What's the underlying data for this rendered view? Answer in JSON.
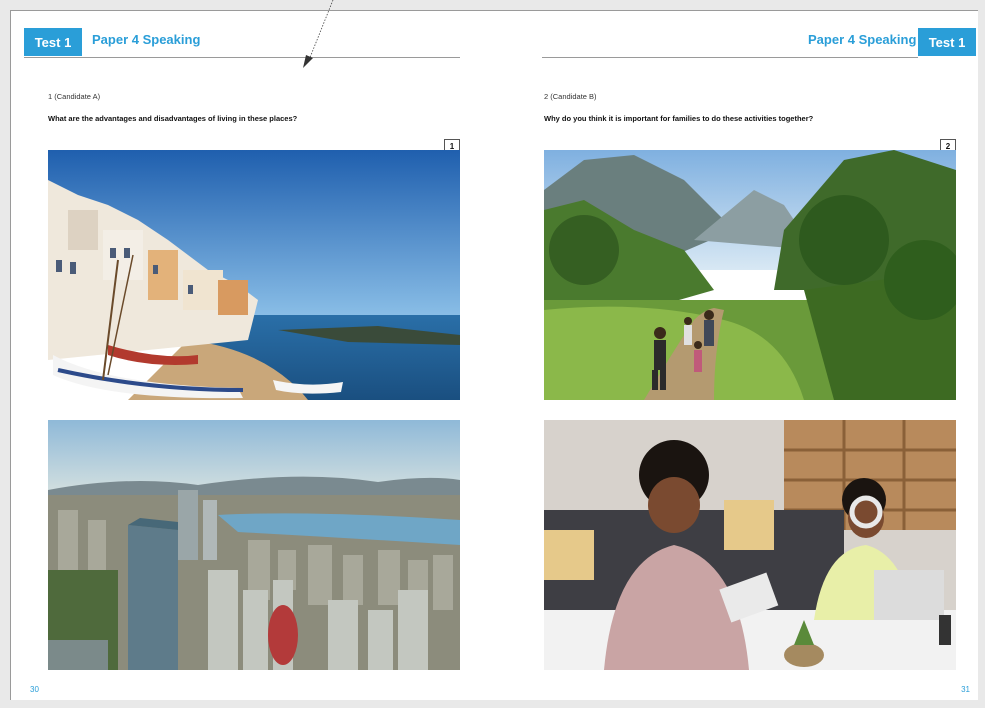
{
  "left_page": {
    "tab_label": "Test 1",
    "header_title": "Paper 4 Speaking",
    "candidate_label": "1 (Candidate A)",
    "question": "What are the advantages and disadvantages of living in these places?",
    "set_number": "1",
    "page_number": "30",
    "photos": [
      "coastal-village-photo",
      "city-skyline-photo"
    ]
  },
  "right_page": {
    "tab_label": "Test 1",
    "header_title": "Paper 4 Speaking",
    "candidate_label": "2 (Candidate B)",
    "question": "Why do you think it is important for families to do these activities together?",
    "set_number": "2",
    "page_number": "31",
    "photos": [
      "family-hiking-photo",
      "family-working-at-home-photo"
    ]
  },
  "colors": {
    "accent": "#2a9ed8",
    "rule": "#9a9a9a"
  }
}
